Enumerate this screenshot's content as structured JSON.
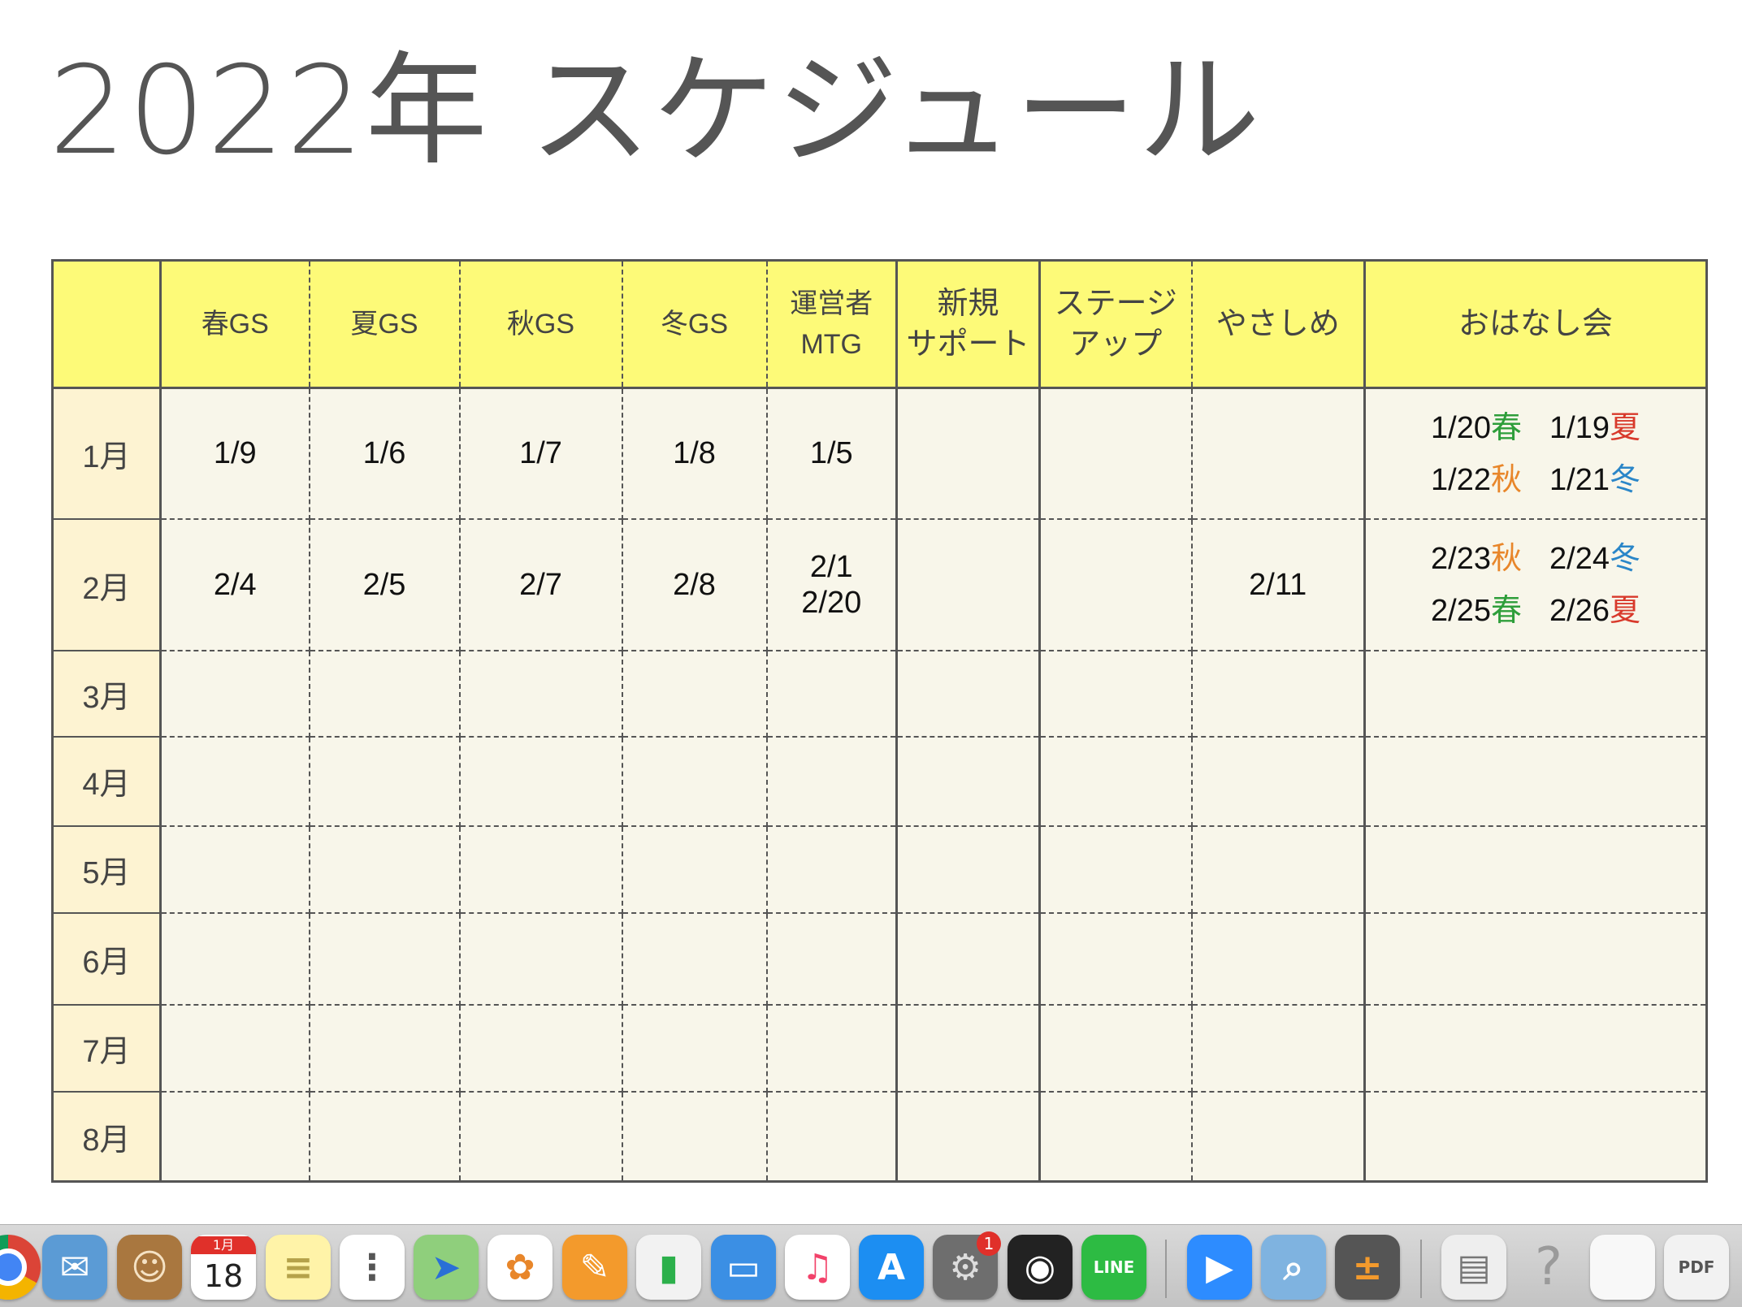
{
  "title": "2022年 スケジュール",
  "colors": {
    "header_bg": "#fdfa78",
    "month_bg": "#fdf3d2",
    "cell_bg": "#f8f6ea",
    "border": "#555555",
    "spring_label": "#2e9e3a",
    "summer_label": "#d8392b",
    "autumn_label": "#e8862a",
    "winter_label": "#2a86c8"
  },
  "table": {
    "headers": [
      "",
      "春GS",
      "夏GS",
      "秋GS",
      "冬GS",
      "運営者\nMTG",
      "新規\nサポート",
      "ステージ\nアップ",
      "やさしめ",
      "おはなし会"
    ],
    "rows": [
      {
        "month": "1月",
        "cells": [
          "1/9",
          "1/6",
          "1/7",
          "1/8",
          "1/5",
          "",
          "",
          ""
        ]
      },
      {
        "month": "2月",
        "cells": [
          "2/4",
          "2/5",
          "2/7",
          "2/8",
          "2/1\n2/20",
          "",
          "",
          "2/11"
        ]
      },
      {
        "month": "3月",
        "cells": [
          "",
          "",
          "",
          "",
          "",
          "",
          "",
          ""
        ]
      },
      {
        "month": "4月",
        "cells": [
          "",
          "",
          "",
          "",
          "",
          "",
          "",
          ""
        ]
      },
      {
        "month": "5月",
        "cells": [
          "",
          "",
          "",
          "",
          "",
          "",
          "",
          ""
        ]
      },
      {
        "month": "6月",
        "cells": [
          "",
          "",
          "",
          "",
          "",
          "",
          "",
          ""
        ]
      },
      {
        "month": "7月",
        "cells": [
          "",
          "",
          "",
          "",
          "",
          "",
          "",
          ""
        ]
      },
      {
        "month": "8月",
        "cells": [
          "",
          "",
          "",
          "",
          "",
          "",
          "",
          ""
        ]
      }
    ],
    "ohanashi": [
      [
        [
          {
            "date": "1/20",
            "season": "春",
            "color": "#2e9e3a"
          },
          {
            "date": "1/19",
            "season": "夏",
            "color": "#d8392b"
          }
        ],
        [
          {
            "date": "1/22",
            "season": "秋",
            "color": "#e8862a"
          },
          {
            "date": "1/21",
            "season": "冬",
            "color": "#2a86c8"
          }
        ]
      ],
      [
        [
          {
            "date": "2/23",
            "season": "秋",
            "color": "#e8862a"
          },
          {
            "date": "2/24",
            "season": "冬",
            "color": "#2a86c8"
          }
        ],
        [
          {
            "date": "2/25",
            "season": "春",
            "color": "#2e9e3a"
          },
          {
            "date": "2/26",
            "season": "夏",
            "color": "#d8392b"
          }
        ]
      ]
    ]
  },
  "dock": {
    "items": [
      {
        "name": "chrome-icon",
        "label": "",
        "bg": "#ffffff",
        "fg": "#db4437"
      },
      {
        "name": "mail-icon",
        "label": "✉",
        "bg": "#5b9bd5",
        "fg": "#ffffff"
      },
      {
        "name": "contacts-icon",
        "label": "☺",
        "bg": "#a9773f",
        "fg": "#f5e2c4"
      },
      {
        "name": "calendar-icon",
        "label": "18",
        "sublabel": "1月",
        "bg": "#ffffff",
        "fg": "#222222"
      },
      {
        "name": "notes-icon",
        "label": "≡",
        "bg": "#fff3a8",
        "fg": "#b5a24a"
      },
      {
        "name": "reminders-icon",
        "label": "⋮",
        "bg": "#ffffff",
        "fg": "#555555"
      },
      {
        "name": "maps-icon",
        "label": "➤",
        "bg": "#8fcf7c",
        "fg": "#2a6fd6"
      },
      {
        "name": "photos-icon",
        "label": "✿",
        "bg": "#ffffff",
        "fg": "#e8862a"
      },
      {
        "name": "pages-icon",
        "label": "✎",
        "bg": "#f39a2c",
        "fg": "#ffffff"
      },
      {
        "name": "numbers-icon",
        "label": "▮",
        "bg": "#f2f2f2",
        "fg": "#2cb04b"
      },
      {
        "name": "keynote-icon",
        "label": "▭",
        "bg": "#3b8fe4",
        "fg": "#ffffff"
      },
      {
        "name": "music-icon",
        "label": "♫",
        "bg": "#ffffff",
        "fg": "#f2426a"
      },
      {
        "name": "app-store-icon",
        "label": "A",
        "bg": "#1c8ef2",
        "fg": "#ffffff"
      },
      {
        "name": "system-preferences-icon",
        "label": "⚙",
        "bg": "#6e6e6e",
        "fg": "#dddddd",
        "badge": "1"
      },
      {
        "name": "obs-icon",
        "label": "◉",
        "bg": "#222222",
        "fg": "#ffffff"
      },
      {
        "name": "line-icon",
        "label": "LINE",
        "bg": "#2dbb43",
        "fg": "#ffffff"
      },
      {
        "name": "zoom-icon",
        "label": "▶",
        "bg": "#2d8cff",
        "fg": "#ffffff"
      },
      {
        "name": "preview-icon",
        "label": "⌕",
        "bg": "#7fb3e0",
        "fg": "#ffffff"
      },
      {
        "name": "calculator-icon",
        "label": "±",
        "bg": "#555555",
        "fg": "#f39a2c"
      },
      {
        "name": "disk-document-icon",
        "label": "▤",
        "bg": "#eeeeee",
        "fg": "#777777"
      },
      {
        "name": "question-mark-icon",
        "label": "?",
        "bg": "transparent",
        "fg": "#9a9a9a"
      },
      {
        "name": "blank-document-icon",
        "label": "",
        "bg": "#f8f8f8",
        "fg": "#777777"
      },
      {
        "name": "pdf-document-icon",
        "label": "PDF",
        "bg": "#f2f2f2",
        "fg": "#555555"
      }
    ]
  }
}
